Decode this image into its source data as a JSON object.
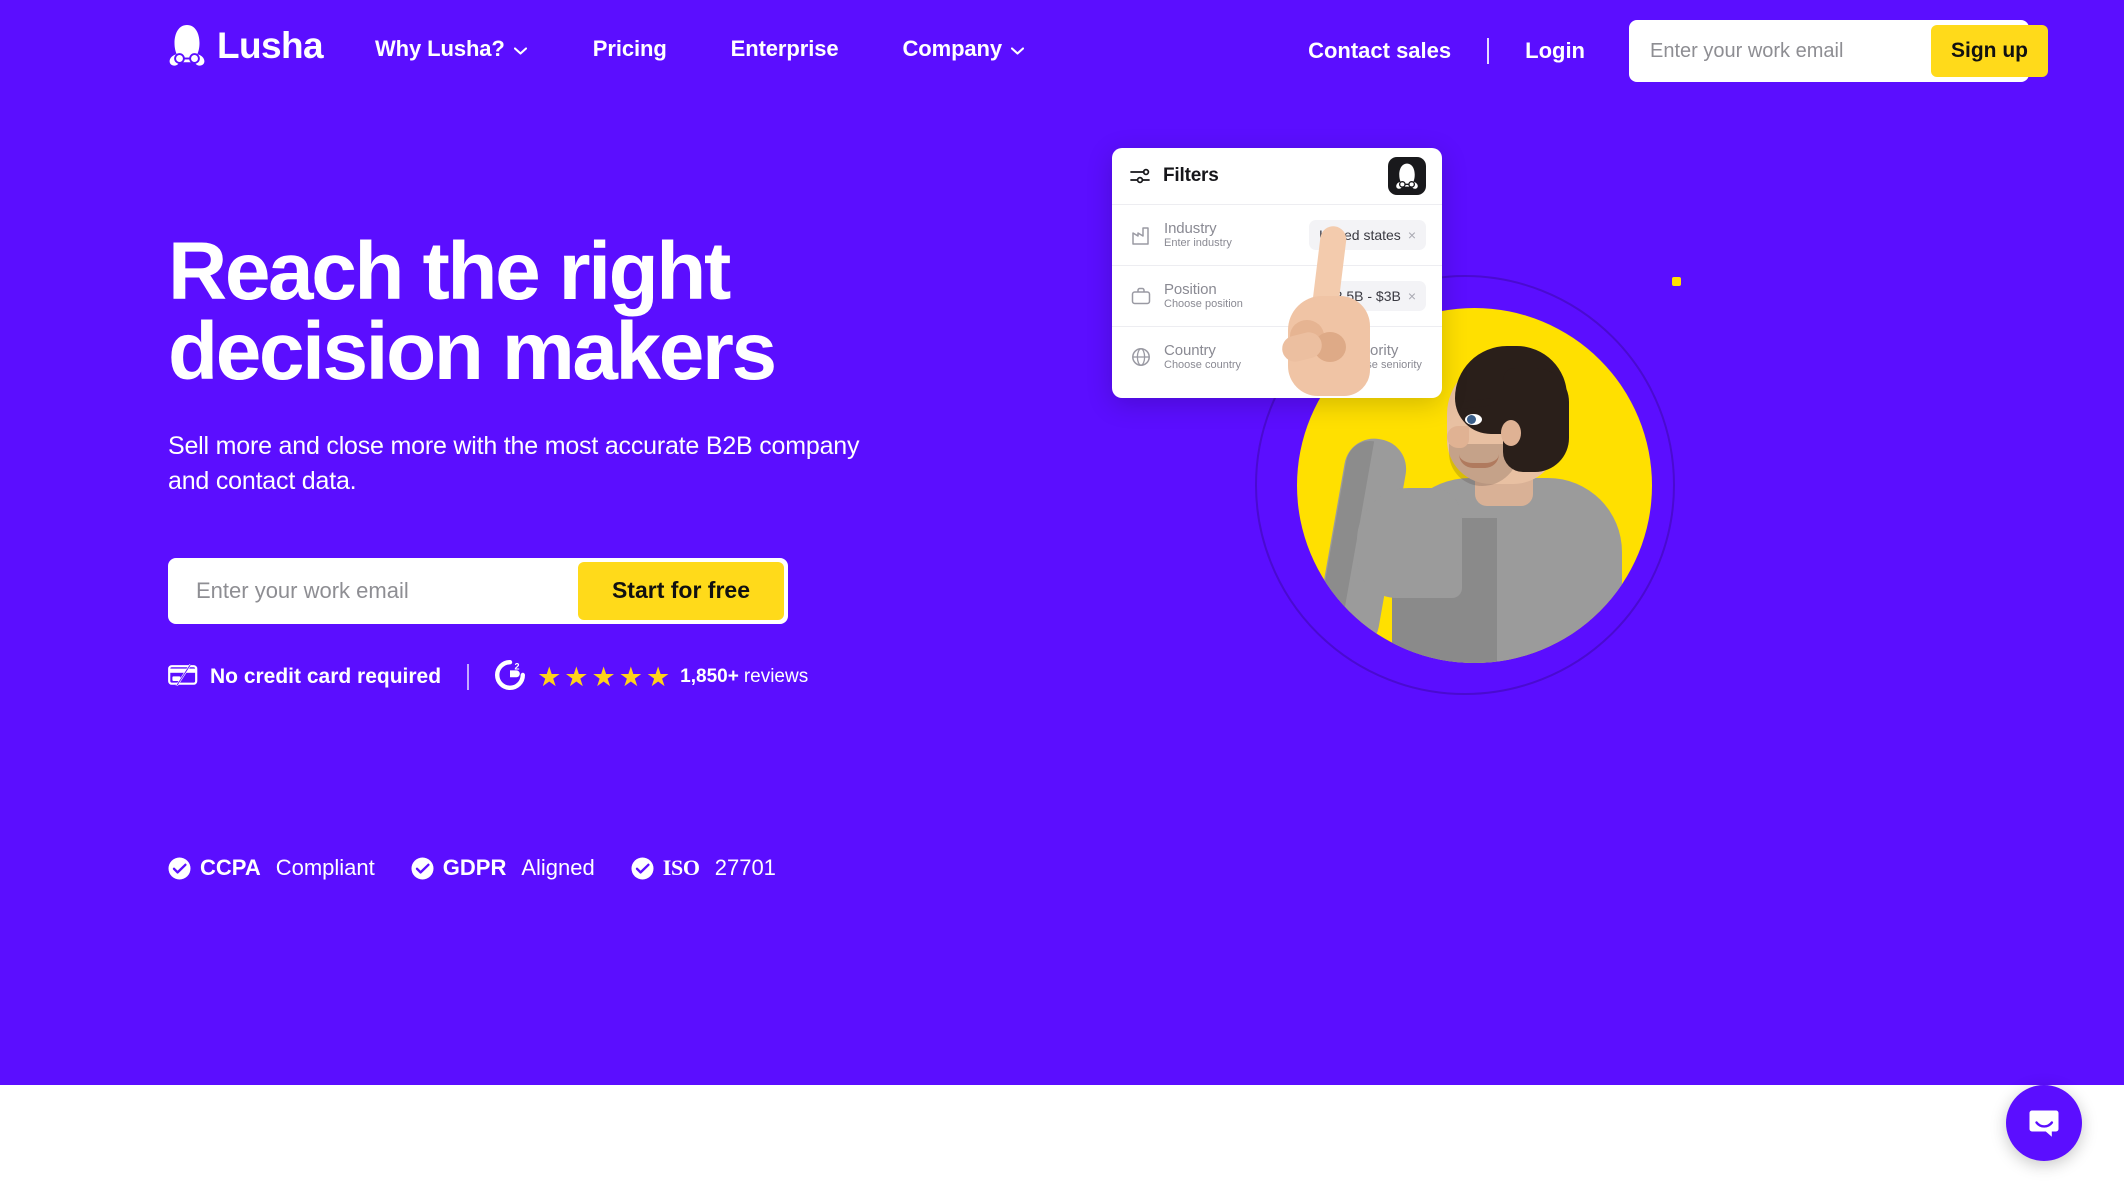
{
  "brand": {
    "name": "Lusha",
    "purple": "#5B0EFF",
    "yellow": "#FFDA1A",
    "ring_purple": "#4A0BD0"
  },
  "header": {
    "logo_label": "Lusha",
    "nav": [
      {
        "label": "Why Lusha?",
        "has_chevron": true
      },
      {
        "label": "Pricing",
        "has_chevron": false
      },
      {
        "label": "Enterprise",
        "has_chevron": false
      },
      {
        "label": "Company",
        "has_chevron": true
      }
    ],
    "contact_sales": "Contact sales",
    "divider": "|",
    "login": "Login",
    "email_placeholder": "Enter your work email",
    "email_value": "",
    "signup_label": "Sign up"
  },
  "hero": {
    "title_line_1": "Reach the right",
    "title_line_2": "decision makers",
    "subtitle": "Sell more and close more with the most accurate B2B company and contact data.",
    "email_placeholder": "Enter your work email",
    "email_value": "",
    "cta_label": "Start for free",
    "no_credit_card": "No credit card required",
    "divider": "|",
    "g2_label": "G2",
    "g2_superscript": "2",
    "stars": [
      "★",
      "★",
      "★",
      "★",
      "★"
    ],
    "star_count": 5,
    "reviews_count": "1,850+",
    "reviews_word": "reviews"
  },
  "compliance": [
    {
      "strong": "CCPA",
      "light": "Compliant",
      "icon": "check-circle-icon"
    },
    {
      "strong": "GDPR",
      "light": "Aligned",
      "icon": "check-circle-icon"
    },
    {
      "strong": "ISO",
      "light": "27701",
      "icon": "check-circle-icon"
    }
  ],
  "filters_card": {
    "title": "Filters",
    "slider_icon": "filter-sliders-icon",
    "badge_icon": "lusha-mascot-icon",
    "rows": [
      {
        "icon": "factory-icon",
        "title": "Industry",
        "subtitle": "Enter industry",
        "chip_text": "United states",
        "chip_close": "×"
      },
      {
        "icon": "briefcase-icon",
        "title": "Position",
        "subtitle": "Choose position",
        "chip_text": "$2.5B - $3B",
        "chip_close": "×"
      },
      {
        "icon": "globe-icon",
        "title": "Country",
        "subtitle": "Choose country",
        "right_icon": "monitor-icon",
        "right_title": "Seniority",
        "right_subtitle": "Choose seniority"
      }
    ]
  },
  "chat": {
    "label": "Open chat",
    "icon": "chat-bubble-smile-icon"
  }
}
